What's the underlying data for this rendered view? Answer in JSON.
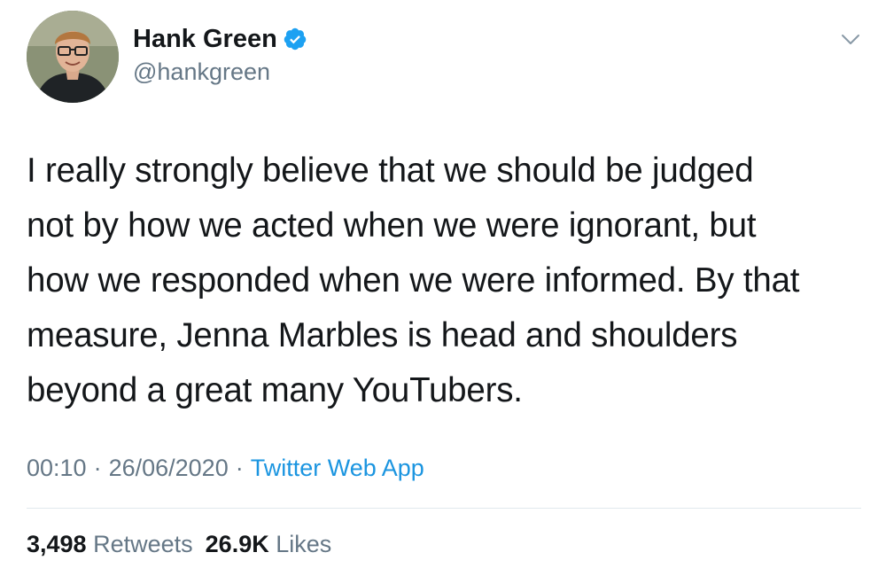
{
  "tweet": {
    "author": {
      "display_name": "Hank Green",
      "handle": "@hankgreen",
      "verified": true
    },
    "text_lines": [
      "I really strongly believe that we should be judged",
      "not by how we acted when we were ignorant, but",
      "how we responded when we were informed. By that",
      "measure, Jenna Marbles is head and shoulders",
      "beyond a great many YouTubers."
    ],
    "meta": {
      "time": "00:10",
      "separator": "·",
      "date": "26/06/2020",
      "source": "Twitter Web App"
    },
    "stats": {
      "retweets_count": "3,498",
      "retweets_label": "Retweets",
      "likes_count": "26.9K",
      "likes_label": "Likes"
    }
  },
  "icons": {
    "verified": "verified-badge-icon",
    "more": "chevron-down-icon"
  },
  "colors": {
    "text_primary": "#14171a",
    "text_secondary": "#657786",
    "link": "#1b95e0",
    "verified": "#1da1f2",
    "divider": "#e1e8ed"
  }
}
